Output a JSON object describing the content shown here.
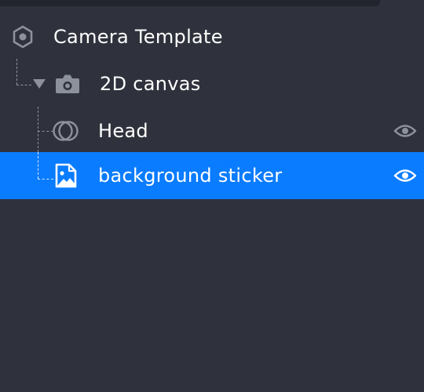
{
  "hierarchy": {
    "items": [
      {
        "label": "Camera Template",
        "icon": "scene-hexagon-icon",
        "expanded": true
      },
      {
        "label": "2D canvas",
        "icon": "camera-icon",
        "expanded": true,
        "caret": "chevron-down-icon"
      },
      {
        "label": "Head",
        "icon": "face-tracker-icon",
        "visibility_icon": "eye-icon"
      },
      {
        "label": "background sticker",
        "icon": "image-sticker-icon",
        "visibility_icon": "eye-icon",
        "selected": true
      }
    ]
  },
  "colors": {
    "panel_background": "#2f323c",
    "selection": "#0a7cff",
    "text": "#ffffff",
    "icon_muted": "#8d919b"
  }
}
